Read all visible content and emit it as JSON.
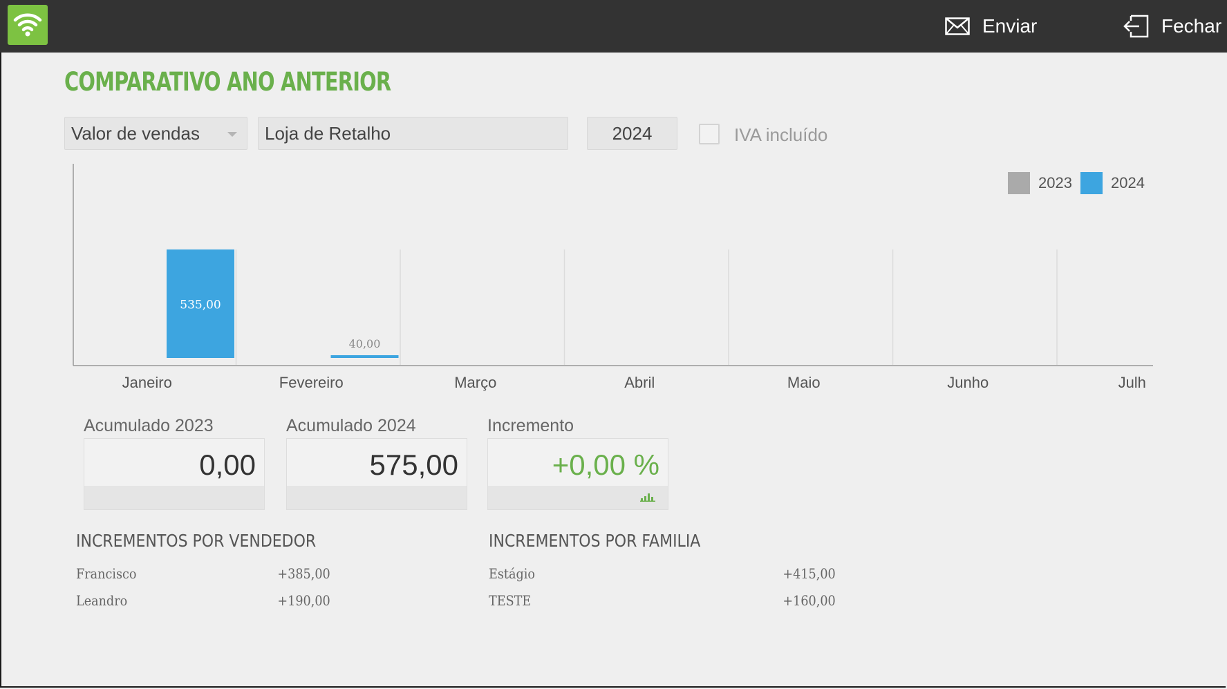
{
  "topbar": {
    "wifi_icon": "wifi-icon",
    "send_label": "Enviar",
    "send_icon": "envelope-icon",
    "close_label": "Fechar",
    "close_icon": "exit-icon",
    "background_color": "#333333",
    "wifi_color": "#7dc242"
  },
  "page": {
    "title": "COMPARATIVO ANO ANTERIOR",
    "title_color": "#6ab04c"
  },
  "filters": {
    "metric_value": "Valor de vendas",
    "store_value": "Loja de Retalho",
    "year_value": "2024",
    "vat_label": "IVA incluído",
    "vat_checked": false
  },
  "chart_data": {
    "type": "bar",
    "categories": [
      "Janeiro",
      "Fevereiro",
      "Março",
      "Abril",
      "Maio",
      "Junho",
      "Julho"
    ],
    "visible_category_labels": [
      "Janeiro",
      "Fevereiro",
      "Março",
      "Abril",
      "Maio",
      "Junho",
      "Julh"
    ],
    "series": [
      {
        "name": "2023",
        "color": "#aaaaaa",
        "values": [
          0,
          0,
          0,
          0,
          0,
          0,
          0
        ]
      },
      {
        "name": "2024",
        "color": "#3da5e0",
        "values": [
          535,
          40,
          0,
          0,
          0,
          0,
          0
        ]
      }
    ],
    "data_labels": [
      "535,00",
      "40,00"
    ],
    "title": "",
    "xlabel": "",
    "ylabel": "",
    "legend_position": "top-right",
    "grid": "vertical separators between months"
  },
  "stats": {
    "accum_prev_label": "Acumulado 2023",
    "accum_prev_value": "0,00",
    "accum_curr_label": "Acumulado 2024",
    "accum_curr_value": "575,00",
    "increment_label": "Incremento",
    "increment_value": "+0,00 %",
    "increment_icon": "bar-chart-icon"
  },
  "by_seller": {
    "title": "INCREMENTOS POR VENDEDOR",
    "rows": [
      {
        "name": "Francisco",
        "value": "+385,00"
      },
      {
        "name": "Leandro",
        "value": "+190,00"
      }
    ]
  },
  "by_family": {
    "title": "INCREMENTOS POR FAMILIA",
    "rows": [
      {
        "name": "Estágio",
        "value": "+415,00"
      },
      {
        "name": "TESTE",
        "value": "+160,00"
      }
    ]
  }
}
